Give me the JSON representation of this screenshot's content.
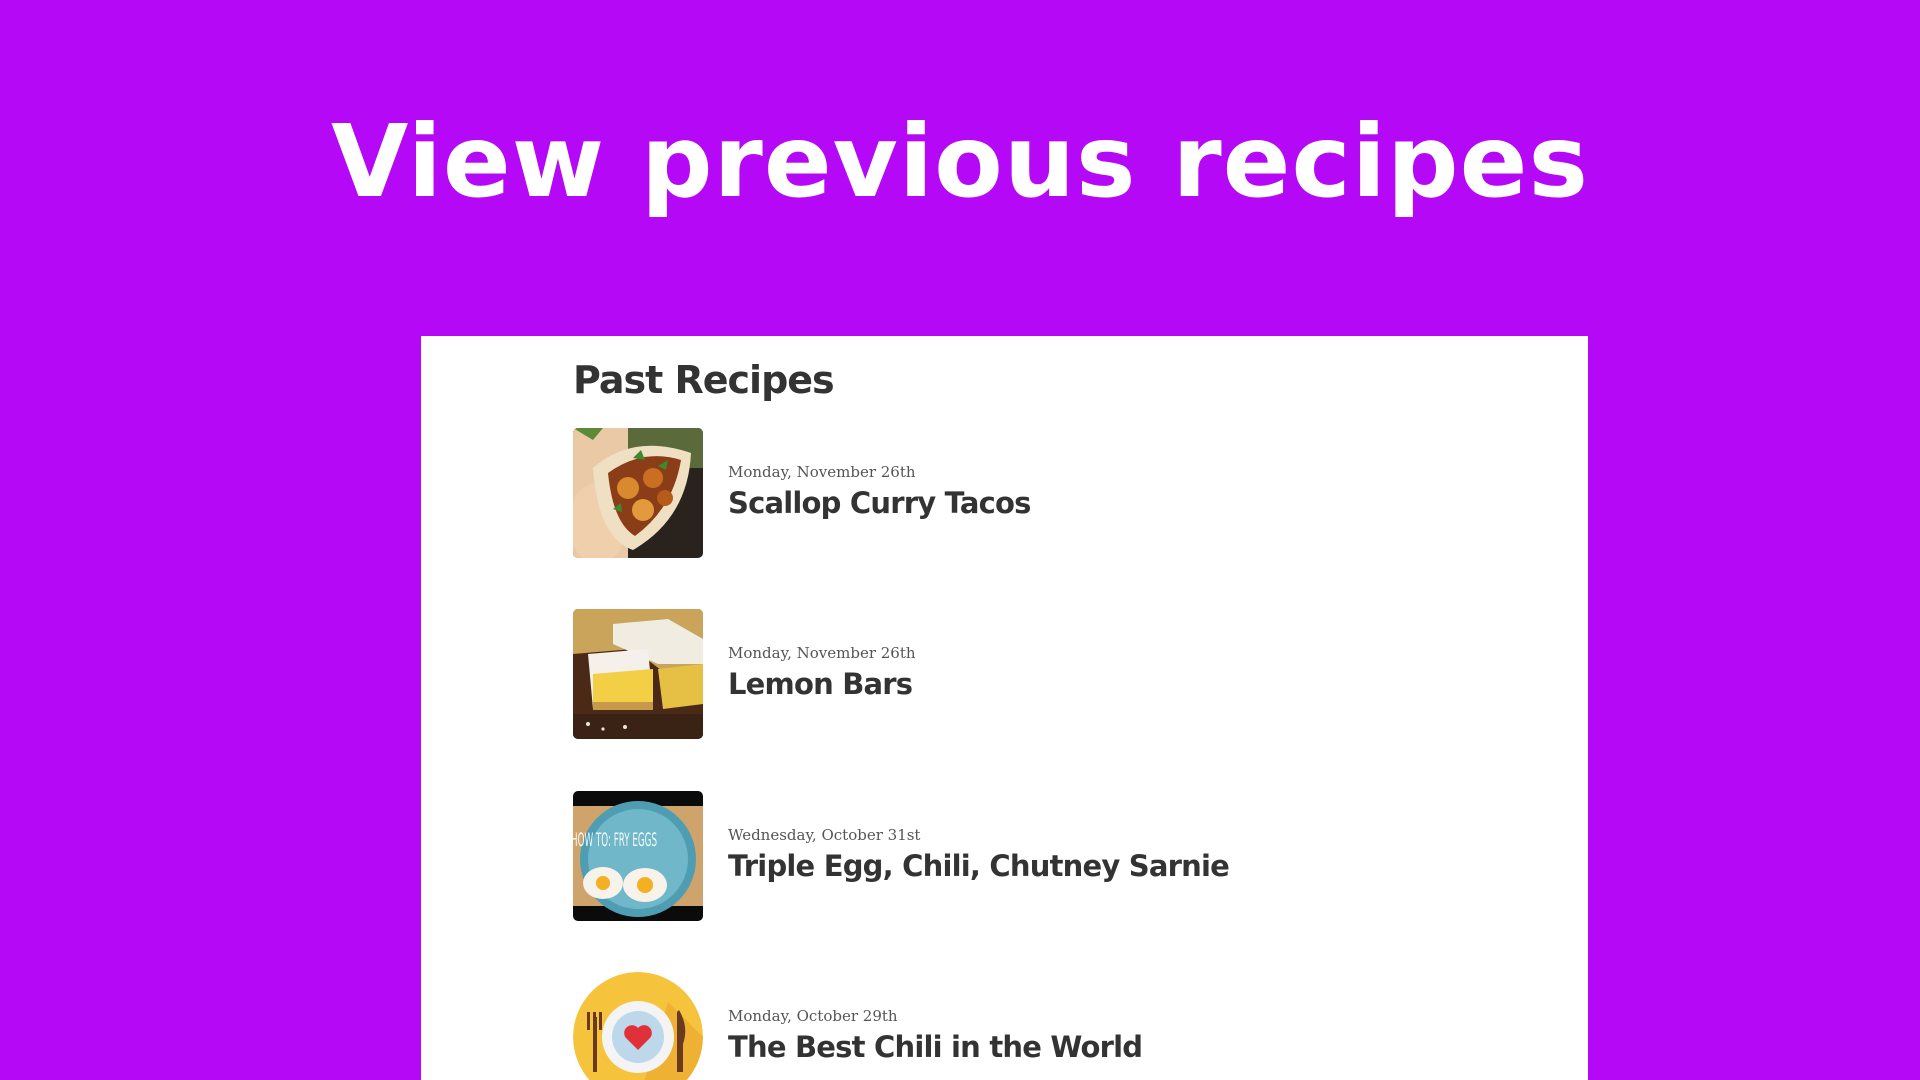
{
  "hero": {
    "title": "View previous recipes"
  },
  "panel": {
    "title": "Past Recipes",
    "recipes": [
      {
        "date": "Monday, November 26th",
        "name": "Scallop Curry Tacos",
        "image": "taco-photo"
      },
      {
        "date": "Monday, November 26th",
        "name": "Lemon Bars",
        "image": "lemon-bars-photo"
      },
      {
        "date": "Wednesday, October 31st",
        "name": "Triple Egg, Chili, Chutney Sarnie",
        "image": "fried-eggs-video-thumbnail",
        "image_text": "HOW TO: FRY EGGS"
      },
      {
        "date": "Monday, October 29th",
        "name": "The Best Chili in the World",
        "image": "plate-with-heart-icon"
      }
    ]
  },
  "colors": {
    "background": "#b408f6",
    "panel": "#ffffff",
    "heading_text": "#333333",
    "date_text": "#555555",
    "hero_text": "#ffffff"
  }
}
